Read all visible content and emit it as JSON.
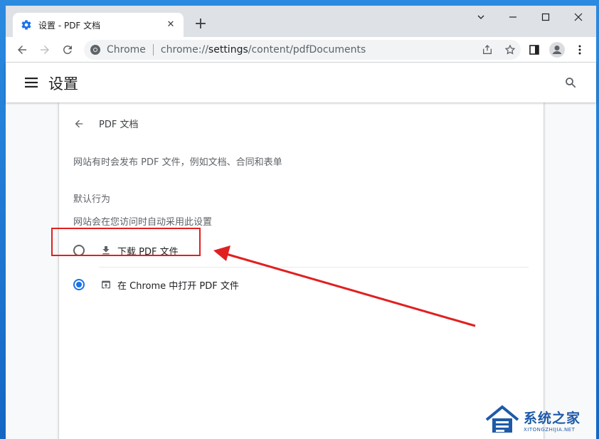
{
  "browser": {
    "tab_title": "设置 - PDF 文档",
    "tab_close": "✕",
    "new_tab": "+",
    "window_controls": {
      "minimize": "⌄",
      "restore": "—",
      "maximize": "☐",
      "close": "✕"
    },
    "site_name": "Chrome",
    "url_scheme": "chrome://",
    "url_host": "settings",
    "url_path": "/content/pdfDocuments"
  },
  "settings": {
    "header_title": "设置",
    "page_title": "PDF 文档",
    "description": "网站有时会发布 PDF 文件，例如文档、合同和表单",
    "section_label": "默认行为",
    "section_sub": "网站会在您访问时自动采用此设置",
    "options": [
      {
        "label": "下载 PDF 文件",
        "icon": "download-icon",
        "selected": false
      },
      {
        "label": "在 Chrome 中打开 PDF 文件",
        "icon": "open-in-browser-icon",
        "selected": true
      }
    ]
  },
  "colors": {
    "accent": "#1a73e8",
    "annotation": "#e02020"
  },
  "watermark": {
    "name": "系统之家",
    "url": "XITONGZHIJIA.NET"
  }
}
